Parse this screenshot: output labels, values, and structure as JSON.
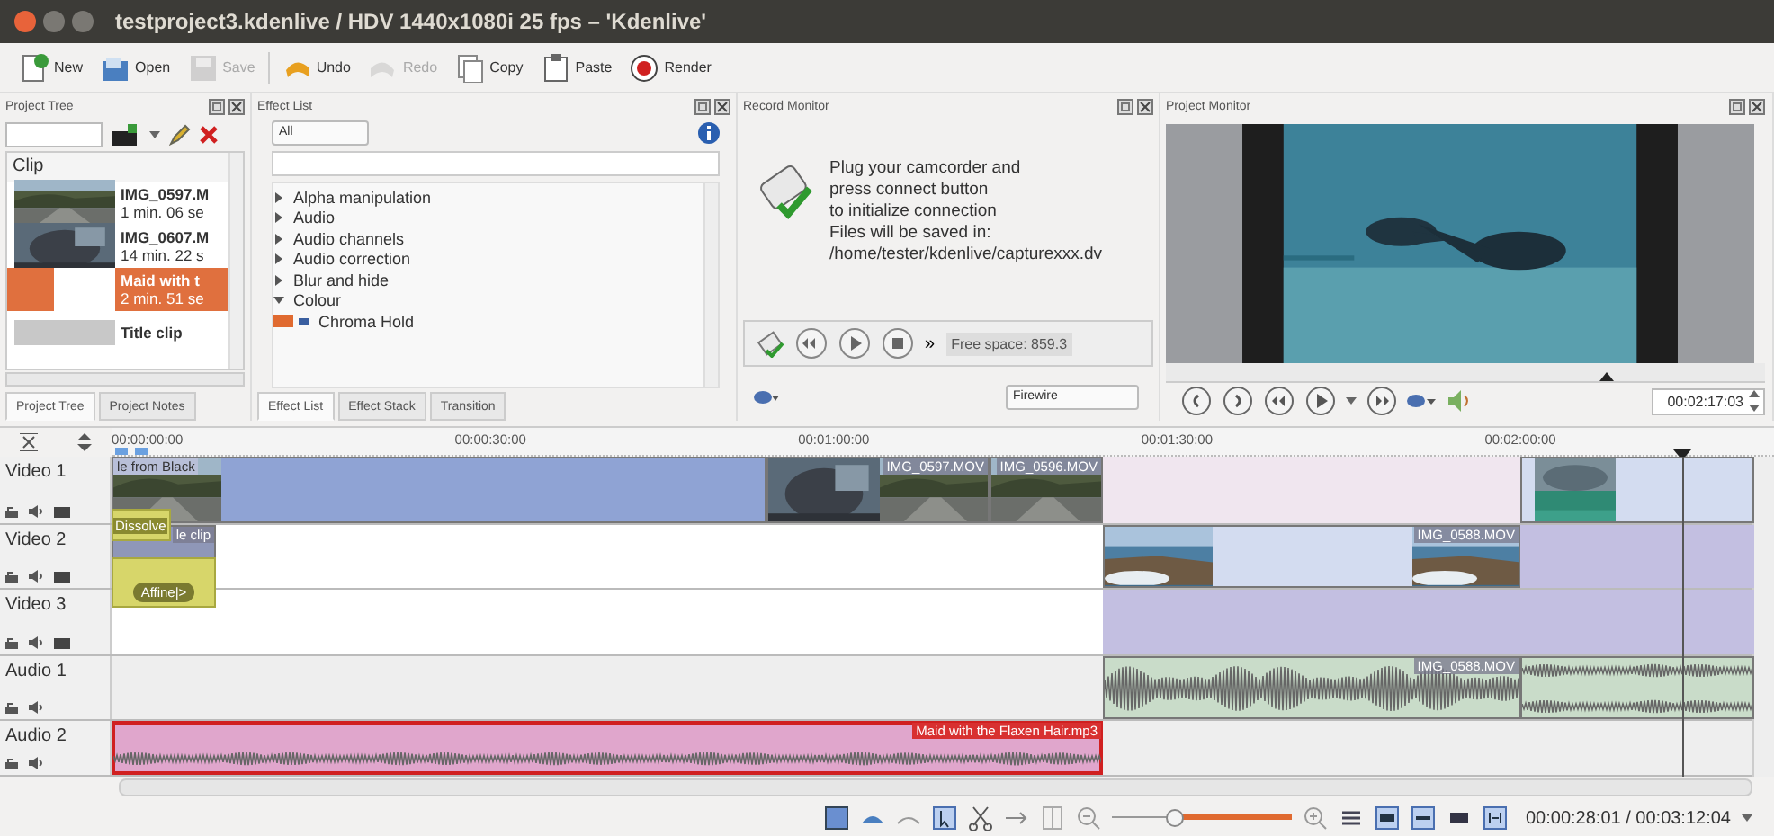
{
  "window": {
    "title": "testproject3.kdenlive / HDV 1440x1080i 25 fps – 'Kdenlive'"
  },
  "toolbar": [
    {
      "kind": "new",
      "label": "New",
      "disabled": false
    },
    {
      "kind": "open",
      "label": "Open",
      "disabled": false
    },
    {
      "kind": "save",
      "label": "Save",
      "disabled": true
    },
    {
      "kind": "undo",
      "label": "Undo",
      "disabled": false
    },
    {
      "kind": "redo",
      "label": "Redo",
      "disabled": true
    },
    {
      "kind": "copy",
      "label": "Copy",
      "disabled": false
    },
    {
      "kind": "paste",
      "label": "Paste",
      "disabled": false
    },
    {
      "kind": "render",
      "label": "Render",
      "disabled": false
    }
  ],
  "project_tree": {
    "title": "Project Tree",
    "column": "Clip",
    "clips": [
      {
        "kind": "picture",
        "name": "IMG_0597.M",
        "duration": "1 min. 06 se",
        "selected": false
      },
      {
        "kind": "picture",
        "name": "IMG_0607.M",
        "duration": "14 min. 22 s",
        "selected": false
      },
      {
        "kind": "blank",
        "name": "Maid with t",
        "duration": "2 min. 51 se",
        "selected": true
      },
      {
        "kind": "title",
        "name": "Title clip",
        "selected": false
      }
    ],
    "tabs": [
      {
        "label": "Project Tree",
        "selected": true
      },
      {
        "label": "Project Notes",
        "selected": false
      }
    ]
  },
  "effect_list": {
    "title": "Effect List",
    "filter": "All",
    "categories": [
      {
        "label": "Alpha manipulation",
        "expanded": false
      },
      {
        "label": "Audio",
        "expanded": false
      },
      {
        "label": "Audio channels",
        "expanded": false
      },
      {
        "label": "Audio correction",
        "expanded": false
      },
      {
        "label": "Blur and hide",
        "expanded": false
      },
      {
        "label": "Colour",
        "expanded": true,
        "children": [
          {
            "label": "Chroma Hold"
          }
        ]
      }
    ],
    "tabs": [
      {
        "label": "Effect List",
        "selected": true
      },
      {
        "label": "Effect Stack",
        "selected": false
      },
      {
        "label": "Transition",
        "selected": false
      }
    ]
  },
  "record_monitor": {
    "title": "Record Monitor",
    "message": "Plug your camcorder and\npress connect button\nto initialize connection\nFiles will be saved in:\n/home/tester/kdenlive/capturexxx.dv",
    "more": "»",
    "free_space": "Free space: 859.3",
    "device": "Firewire"
  },
  "project_monitor": {
    "title": "Project Monitor",
    "timecode": "00:02:17:03"
  },
  "timeline": {
    "ruler": [
      "00:00:00:00",
      "00:00:30:00",
      "00:01:00:00",
      "00:01:30:00",
      "00:02:00:00"
    ],
    "tracks": [
      {
        "name": "Video 1",
        "kind": "video",
        "clips": [
          {
            "kind": "video",
            "name": "le from Black",
            "selected": false
          },
          {
            "kind": "video",
            "name": "IMG_0597.MOV",
            "selected": false
          },
          {
            "kind": "video",
            "name": "IMG_0596.MOV",
            "selected": false
          },
          {
            "kind": "region"
          },
          {
            "kind": "video",
            "selected": false
          }
        ]
      },
      {
        "name": "Video 2",
        "kind": "video",
        "clips": [
          {
            "kind": "video",
            "name": "le clip",
            "selected": false
          },
          {
            "kind": "transition",
            "name": "Dissolve"
          },
          {
            "kind": "video",
            "name": "IMG_0588.MOV",
            "selected": false
          },
          {
            "kind": "region"
          }
        ]
      },
      {
        "name": "Video 3",
        "kind": "video",
        "clips": [
          {
            "kind": "transition",
            "name": "Affine|>"
          },
          {
            "kind": "region"
          }
        ]
      },
      {
        "name": "Audio 1",
        "kind": "audio",
        "clips": [
          {
            "kind": "audio",
            "name": "IMG_0588.MOV",
            "selected": false
          },
          {
            "kind": "audio",
            "selected": false
          }
        ]
      },
      {
        "name": "Audio 2",
        "kind": "audio",
        "clips": [
          {
            "kind": "music",
            "name": "Maid with the Flaxen Hair.mp3",
            "selected": true
          }
        ]
      }
    ]
  },
  "status_bar": {
    "zoom": {
      "level": 0.35
    },
    "timecode": "00:00:28:01 / 00:03:12:04"
  }
}
